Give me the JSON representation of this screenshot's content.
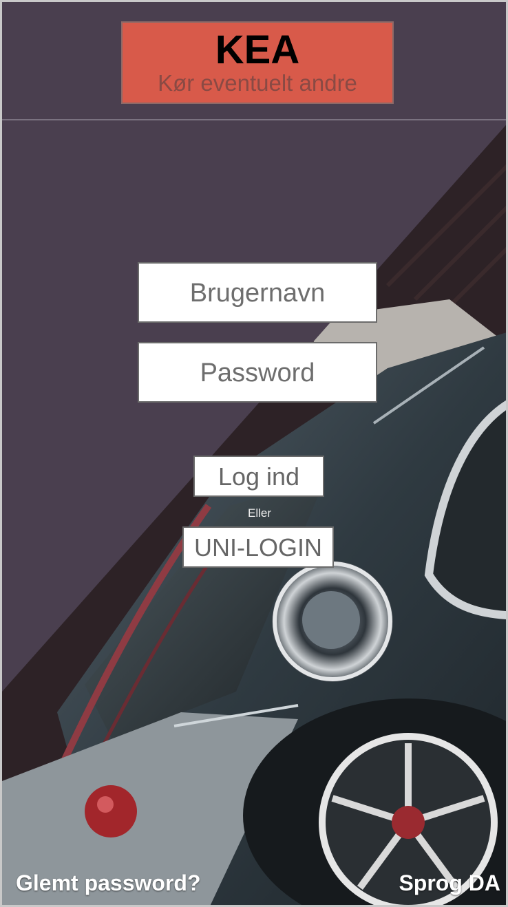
{
  "header": {
    "logo_title": "KEA",
    "logo_subtitle": "Kør eventuelt andre"
  },
  "login": {
    "username_placeholder": "Brugernavn",
    "password_placeholder": "Password",
    "login_button": "Log ind",
    "or_label": "Eller",
    "unilogin_button": "UNI-LOGIN"
  },
  "footer": {
    "forgot_password": "Glemt password?",
    "language": "Sprog DA"
  },
  "background_image": "car-photo",
  "colors": {
    "background": "#4a3f4f",
    "brand": "#d85a4a",
    "text_on_dark": "#ffffff"
  }
}
